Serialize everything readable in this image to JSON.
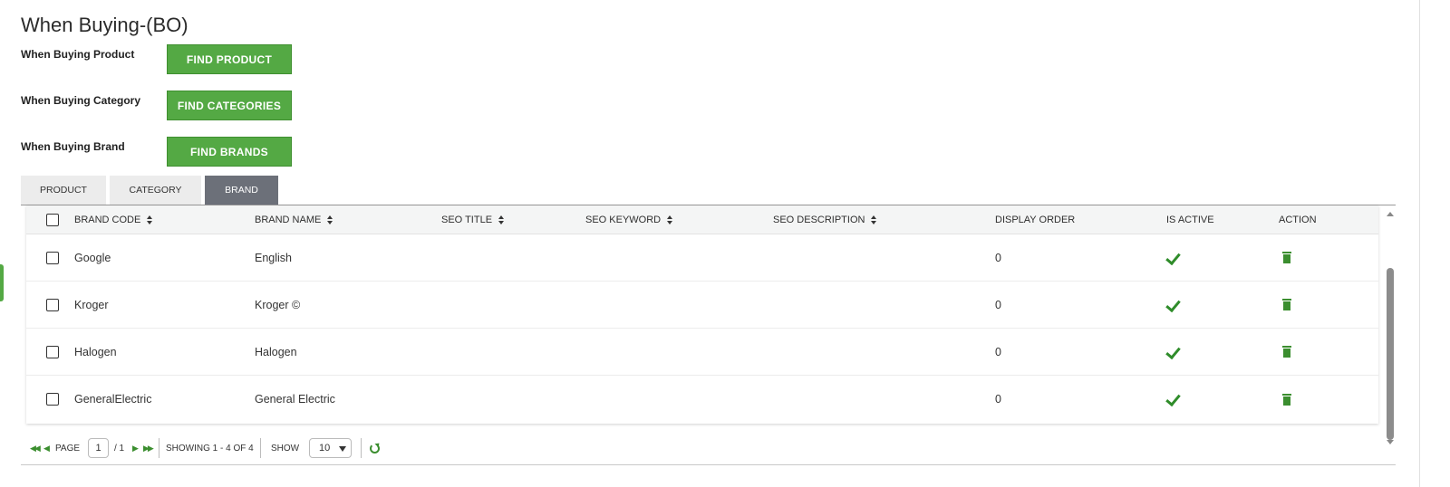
{
  "page": {
    "title": "When Buying-(BO)"
  },
  "find": [
    {
      "label": "When Buying Product",
      "button": "FIND PRODUCT"
    },
    {
      "label": "When Buying Category",
      "button": "FIND CATEGORIES"
    },
    {
      "label": "When Buying Brand",
      "button": "FIND BRANDS"
    }
  ],
  "tabs": [
    {
      "label": "PRODUCT",
      "active": false
    },
    {
      "label": "CATEGORY",
      "active": false
    },
    {
      "label": "BRAND",
      "active": true
    }
  ],
  "grid": {
    "columns": [
      "BRAND CODE",
      "BRAND NAME",
      "SEO TITLE",
      "SEO KEYWORD",
      "SEO DESCRIPTION",
      "DISPLAY ORDER",
      "IS ACTIVE",
      "ACTION"
    ],
    "rows": [
      {
        "code": "Google",
        "name": "English",
        "seo_title": "",
        "seo_keyword": "",
        "seo_description": "",
        "display_order": "0",
        "is_active": true
      },
      {
        "code": "Kroger",
        "name": "Kroger ©",
        "seo_title": "",
        "seo_keyword": "",
        "seo_description": "",
        "display_order": "0",
        "is_active": true
      },
      {
        "code": "Halogen",
        "name": "Halogen",
        "seo_title": "",
        "seo_keyword": "",
        "seo_description": "",
        "display_order": "0",
        "is_active": true
      },
      {
        "code": "GeneralElectric",
        "name": "General Electric",
        "seo_title": "",
        "seo_keyword": "",
        "seo_description": "",
        "display_order": "0",
        "is_active": true
      }
    ]
  },
  "pager": {
    "page_label": "PAGE",
    "page_value": "1",
    "page_total": "/ 1",
    "showing": "SHOWING 1 - 4 OF 4",
    "show_label": "SHOW",
    "show_value": "10"
  },
  "icons": {
    "first": "double-left-arrow-icon",
    "prev": "left-arrow-icon",
    "next": "right-arrow-icon",
    "last": "double-right-arrow-icon",
    "refresh": "refresh-icon",
    "active": "check-icon",
    "delete": "trash-icon"
  },
  "colors": {
    "accent": "#54a944",
    "tab_active": "#6c7079",
    "icon_green": "#3b8e2f"
  }
}
